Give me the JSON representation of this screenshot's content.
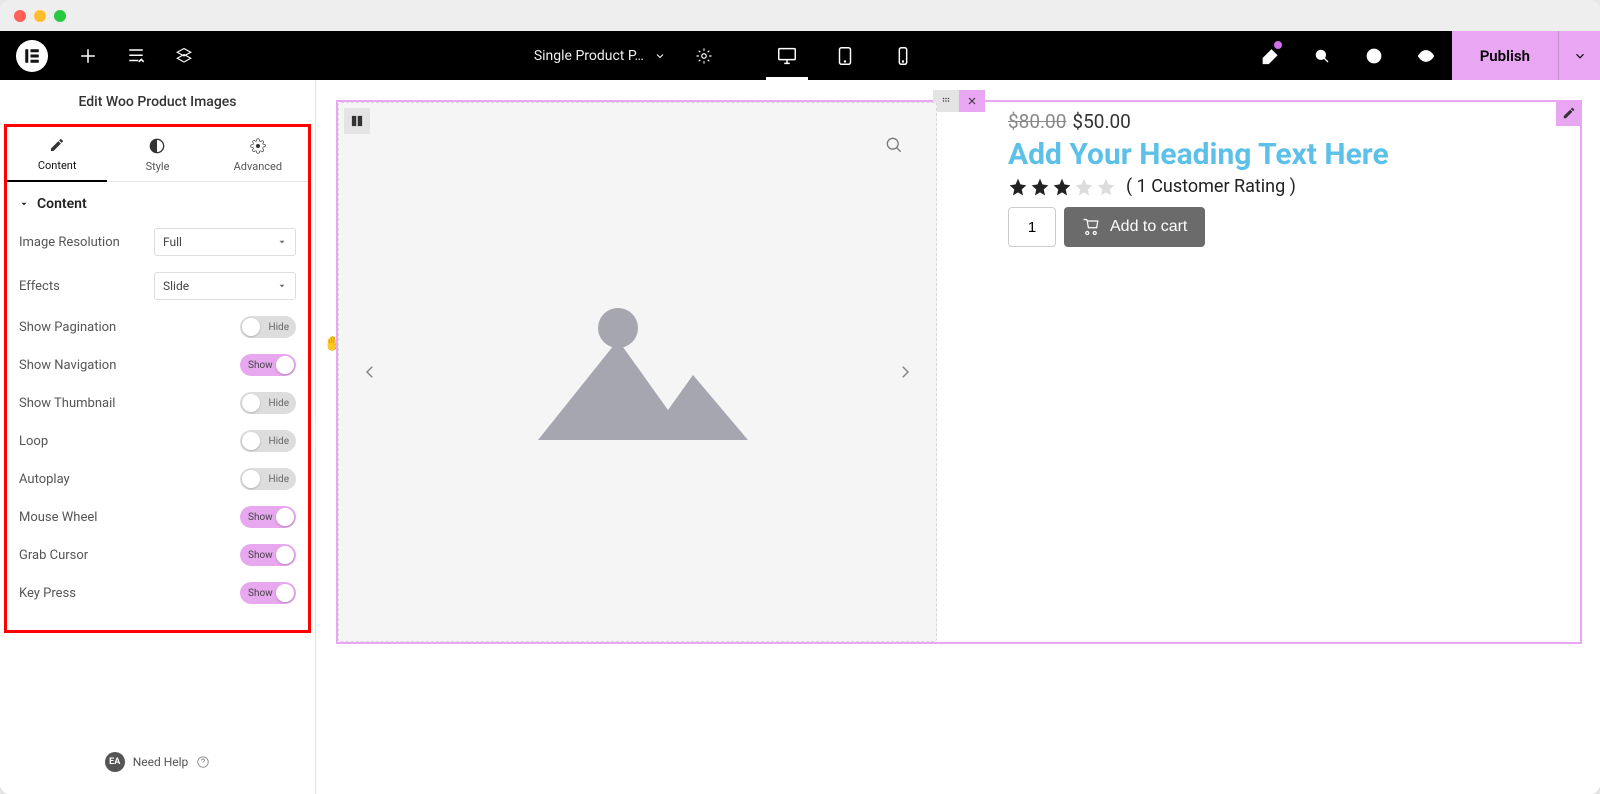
{
  "topbar": {
    "doc_title": "Single Product P…",
    "publish": "Publish"
  },
  "panel": {
    "title": "Edit Woo Product Images",
    "tabs": {
      "content": "Content",
      "style": "Style",
      "advanced": "Advanced"
    },
    "section": "Content",
    "controls": {
      "image_resolution": {
        "label": "Image Resolution",
        "value": "Full"
      },
      "effects": {
        "label": "Effects",
        "value": "Slide"
      },
      "show_pagination": {
        "label": "Show Pagination",
        "on": false,
        "text": "Hide"
      },
      "show_navigation": {
        "label": "Show Navigation",
        "on": true,
        "text": "Show"
      },
      "show_thumbnail": {
        "label": "Show Thumbnail",
        "on": false,
        "text": "Hide"
      },
      "loop": {
        "label": "Loop",
        "on": false,
        "text": "Hide"
      },
      "autoplay": {
        "label": "Autoplay",
        "on": false,
        "text": "Hide"
      },
      "mouse_wheel": {
        "label": "Mouse Wheel",
        "on": true,
        "text": "Show"
      },
      "grab_cursor": {
        "label": "Grab Cursor",
        "on": true,
        "text": "Show"
      },
      "key_press": {
        "label": "Key Press",
        "on": true,
        "text": "Show"
      }
    },
    "help": "Need Help"
  },
  "product": {
    "price_old": "$80.00",
    "price_new": "$50.00",
    "heading": "Add Your Heading Text Here",
    "rating_text": "( 1 Customer Rating )",
    "qty": "1",
    "add_to_cart": "Add to cart"
  }
}
